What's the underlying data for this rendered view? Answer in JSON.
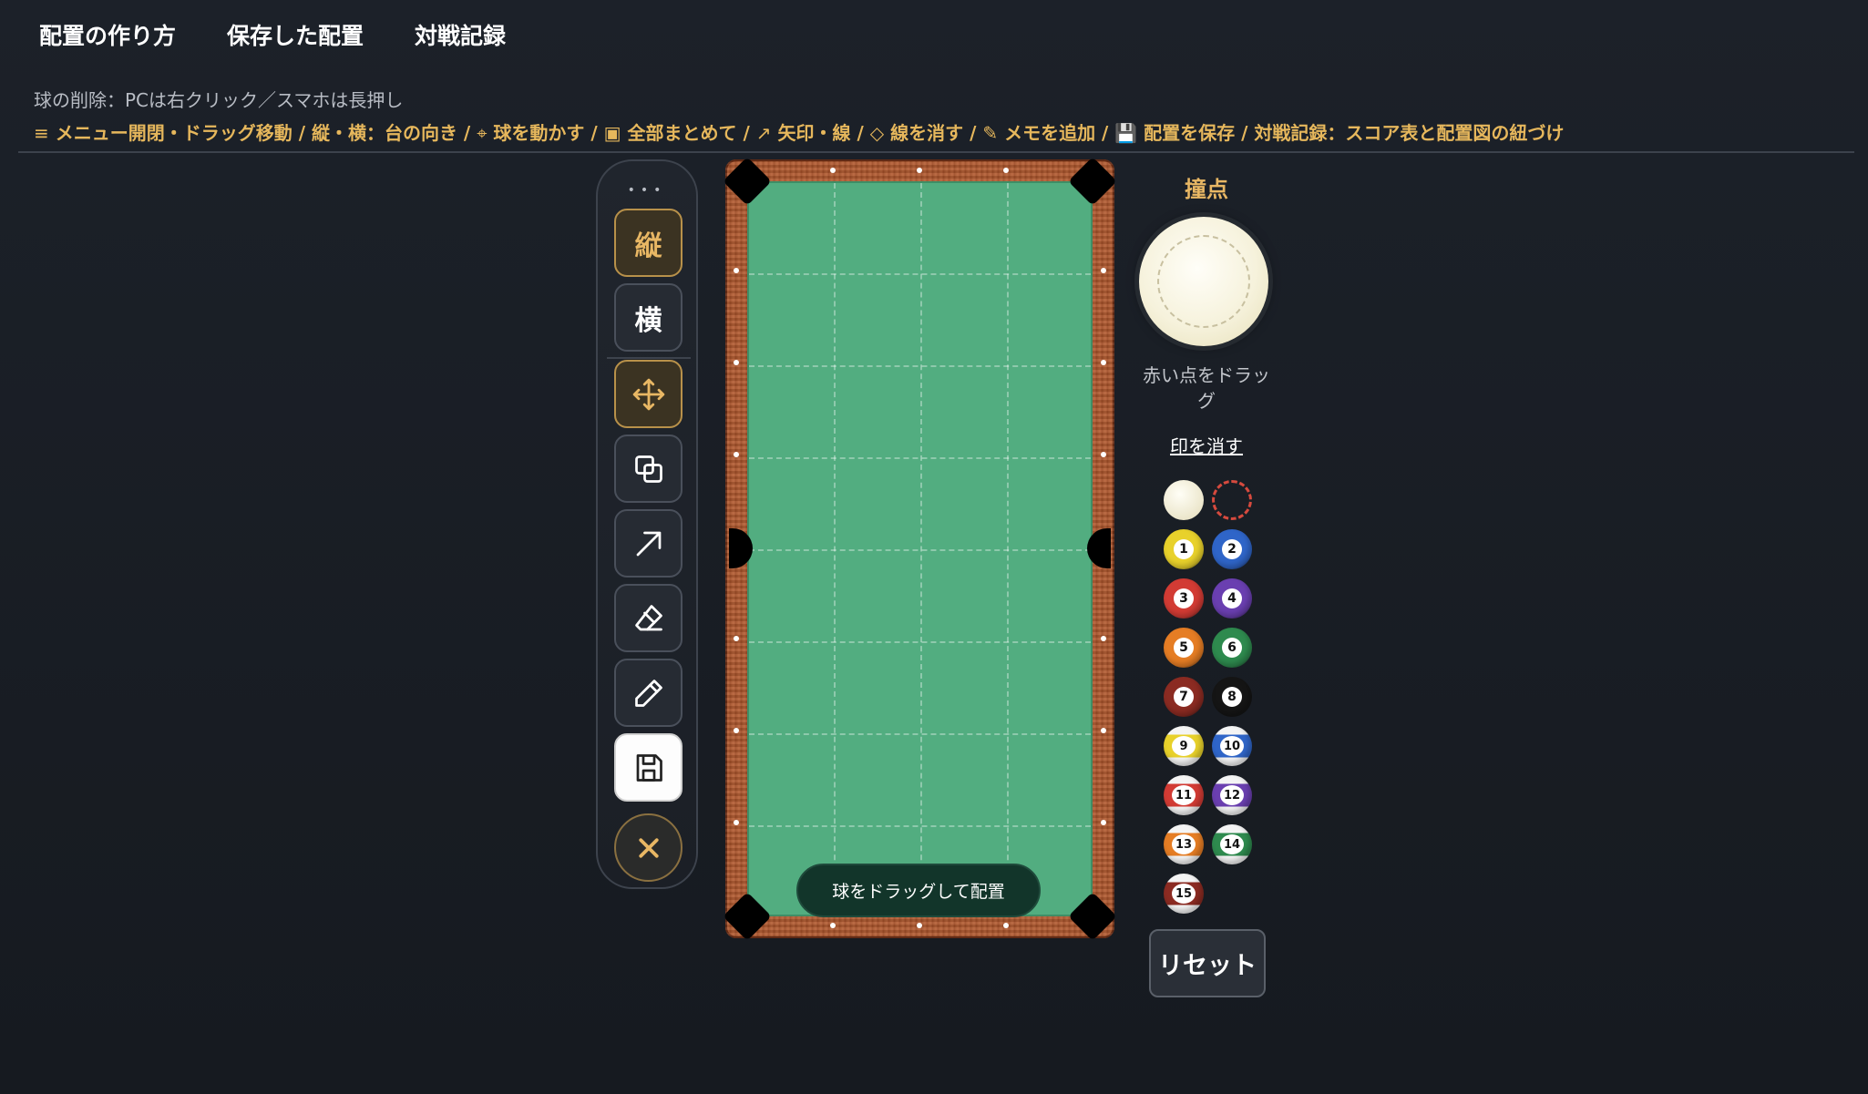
{
  "nav": {
    "how_to": "配置の作り方",
    "saved": "保存した配置",
    "records": "対戦記録"
  },
  "hints": {
    "delete": "球の削除：PCは右クリック／スマホは長押し",
    "line2": [
      {
        "icon": "≡",
        "text": " メニュー開閉・ドラッグ移動 / 縦・横：台の向き / "
      },
      {
        "icon": "⌖",
        "text": " 球を動かす / "
      },
      {
        "icon": "▣",
        "text": " 全部まとめて / "
      },
      {
        "icon": "↗",
        "text": " 矢印・線 / "
      },
      {
        "icon": "◇",
        "text": " 線を消す / "
      },
      {
        "icon": "✎",
        "text": " メモを追加 / "
      },
      {
        "icon": "💾",
        "text": " 配置を保存 / 対戦記録：スコア表と配置図の紐づけ"
      }
    ]
  },
  "toolbar": {
    "dots": "•••",
    "vertical": "縦",
    "horizontal": "横"
  },
  "table": {
    "hint": "球をドラッグして配置"
  },
  "panel": {
    "title": "撞点",
    "drag_hint": "赤い点をドラッグ",
    "clear": "印を消す",
    "reset": "リセット"
  },
  "balls": [
    {
      "n": "1",
      "color": "#e8d12b",
      "stripe": false
    },
    {
      "n": "2",
      "color": "#2f65c8",
      "stripe": false
    },
    {
      "n": "3",
      "color": "#d23b34",
      "stripe": false
    },
    {
      "n": "4",
      "color": "#6a3fb0",
      "stripe": false
    },
    {
      "n": "5",
      "color": "#e57d24",
      "stripe": false
    },
    {
      "n": "6",
      "color": "#2e8a4e",
      "stripe": false
    },
    {
      "n": "7",
      "color": "#8b2b22",
      "stripe": false
    },
    {
      "n": "8",
      "color": "#151515",
      "stripe": false
    },
    {
      "n": "9",
      "color": "#e8d12b",
      "stripe": true
    },
    {
      "n": "10",
      "color": "#2f65c8",
      "stripe": true
    },
    {
      "n": "11",
      "color": "#d23b34",
      "stripe": true
    },
    {
      "n": "12",
      "color": "#6a3fb0",
      "stripe": true
    },
    {
      "n": "13",
      "color": "#e57d24",
      "stripe": true
    },
    {
      "n": "14",
      "color": "#2e8a4e",
      "stripe": true
    },
    {
      "n": "15",
      "color": "#8b2b22",
      "stripe": true
    }
  ]
}
